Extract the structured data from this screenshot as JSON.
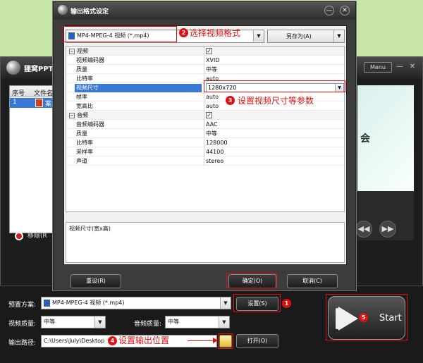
{
  "main_window": {
    "title": "狸窝PPT",
    "menu_label": "Menu",
    "min_glyph": "—",
    "close_glyph": "✕",
    "list_headers": [
      "序号",
      "文件名"
    ],
    "list_row": {
      "number": "1",
      "name": "案"
    },
    "remove_label": "移除(R",
    "preview_text": "会",
    "rewind_glyph": "◀◀",
    "next_glyph": "▶▶"
  },
  "bottom": {
    "preset_label": "预置方案:",
    "preset_value": "MP4-MPEG-4 视频 (*.mp4)",
    "settings_button": "设置(S)",
    "video_quality_label": "视频质量:",
    "video_quality_value": "中等",
    "audio_quality_label": "音频质量:",
    "audio_quality_value": "中等",
    "output_path_label": "输出路径:",
    "output_path_value": "C:\\Users\\July\\Desktop",
    "open_button": "打开(O)",
    "start_label": "Start"
  },
  "dialog": {
    "title": "输出格式设定",
    "min_glyph": "—",
    "close_glyph": "✕",
    "format_value": "MP4-MPEG-4 视频 (*.mp4)",
    "saveas_label": "另存为(A)",
    "properties": [
      {
        "type": "section",
        "key": "视频",
        "value": "✓"
      },
      {
        "type": "prop",
        "key": "视频编码器",
        "value": "XVID"
      },
      {
        "type": "prop",
        "key": "质量",
        "value": "中等"
      },
      {
        "type": "prop",
        "key": "比特率",
        "value": "auto"
      },
      {
        "type": "selected",
        "key": "视频尺寸",
        "value": "1280x720"
      },
      {
        "type": "prop",
        "key": "帧率",
        "value": "auto"
      },
      {
        "type": "prop",
        "key": "宽高比",
        "value": "auto"
      },
      {
        "type": "section",
        "key": "音频",
        "value": "✓"
      },
      {
        "type": "prop",
        "key": "音频编码器",
        "value": "AAC"
      },
      {
        "type": "prop",
        "key": "质量",
        "value": "中等"
      },
      {
        "type": "prop",
        "key": "比特率",
        "value": "128000"
      },
      {
        "type": "prop",
        "key": "采样率",
        "value": "44100"
      },
      {
        "type": "prop",
        "key": "声道",
        "value": "stereo"
      }
    ],
    "description": "视频尺寸(宽x高)",
    "reset_button": "重设(R)",
    "ok_button": "确定(O)",
    "cancel_button": "取消(C)"
  },
  "annotations": {
    "step1": "1",
    "step2": "2",
    "step3": "3",
    "step4": "4",
    "step5": "5",
    "note2": "选择视频格式",
    "note3": "设置视频尺寸等参数",
    "note4": "设置输出位置",
    "annotation_color": "#e01010"
  }
}
